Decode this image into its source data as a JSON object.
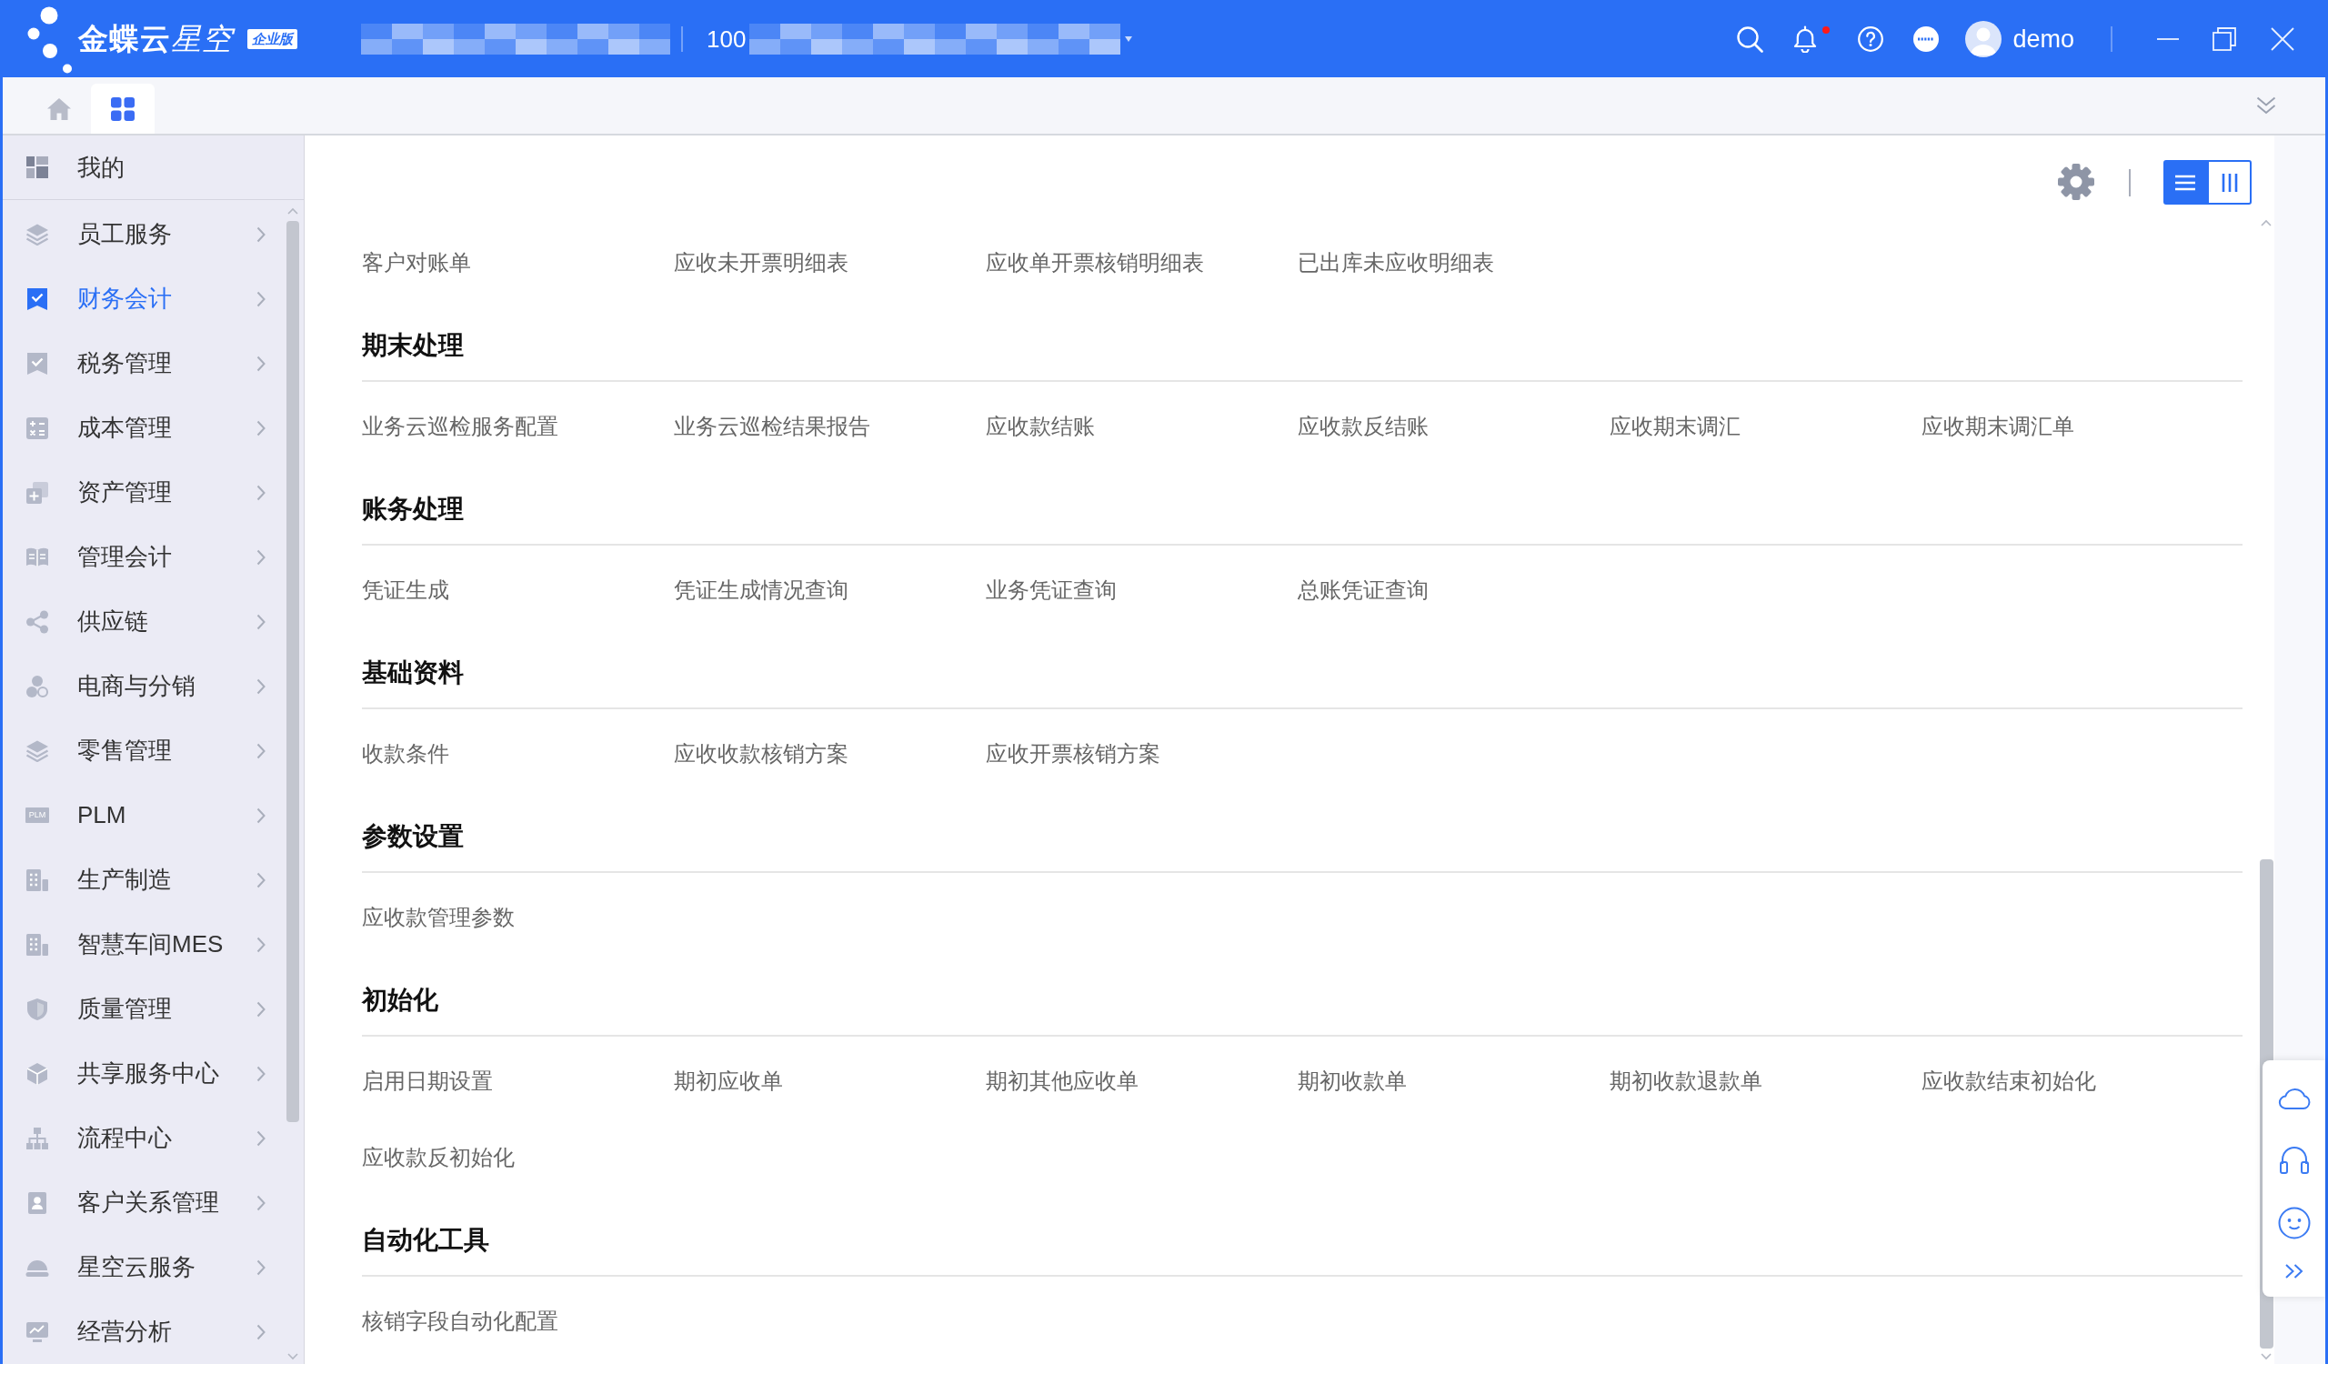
{
  "titlebar": {
    "brand": "金蝶云",
    "brand_suffix": "星空",
    "edition": "企业版",
    "org_code": "100",
    "user": "demo",
    "notification_unread": true
  },
  "tabs": [
    {
      "kind": "home",
      "selected": false
    },
    {
      "kind": "apps",
      "selected": true
    }
  ],
  "sidebar": {
    "pinned": {
      "label": "我的",
      "selected": false
    },
    "items": [
      {
        "label": "员工服务",
        "selected": false
      },
      {
        "label": "财务会计",
        "selected": true
      },
      {
        "label": "税务管理",
        "selected": false
      },
      {
        "label": "成本管理",
        "selected": false
      },
      {
        "label": "资产管理",
        "selected": false
      },
      {
        "label": "管理会计",
        "selected": false
      },
      {
        "label": "供应链",
        "selected": false
      },
      {
        "label": "电商与分销",
        "selected": false
      },
      {
        "label": "零售管理",
        "selected": false
      },
      {
        "label": "PLM",
        "icon_text": "PLM",
        "selected": false
      },
      {
        "label": "生产制造",
        "selected": false
      },
      {
        "label": "智慧车间MES",
        "selected": false
      },
      {
        "label": "质量管理",
        "selected": false
      },
      {
        "label": "共享服务中心",
        "selected": false
      },
      {
        "label": "流程中心",
        "selected": false
      },
      {
        "label": "客户关系管理",
        "selected": false
      },
      {
        "label": "星空云服务",
        "selected": false
      },
      {
        "label": "经营分析",
        "selected": false
      }
    ]
  },
  "content": {
    "view_modes": [
      {
        "kind": "list",
        "selected": true
      },
      {
        "kind": "columns",
        "selected": false
      }
    ],
    "sections": [
      {
        "items": [
          "客户对账单",
          "应收未开票明细表",
          "应收单开票核销明细表",
          "已出库未应收明细表"
        ]
      },
      {
        "title": "期末处理",
        "items": [
          "业务云巡检服务配置",
          "业务云巡检结果报告",
          "应收款结账",
          "应收款反结账",
          "应收期末调汇",
          "应收期末调汇单"
        ]
      },
      {
        "title": "账务处理",
        "items": [
          "凭证生成",
          "凭证生成情况查询",
          "业务凭证查询",
          "总账凭证查询"
        ]
      },
      {
        "title": "基础资料",
        "items": [
          "收款条件",
          "应收收款核销方案",
          "应收开票核销方案"
        ]
      },
      {
        "title": "参数设置",
        "items": [
          "应收款管理参数"
        ]
      },
      {
        "title": "初始化",
        "items": [
          "启用日期设置",
          "期初应收单",
          "期初其他应收单",
          "期初收款单",
          "期初收款退款单",
          "应收款结束初始化",
          "应收款反初始化"
        ]
      },
      {
        "title": "自动化工具",
        "items": [
          "核销字段自动化配置"
        ]
      }
    ]
  }
}
